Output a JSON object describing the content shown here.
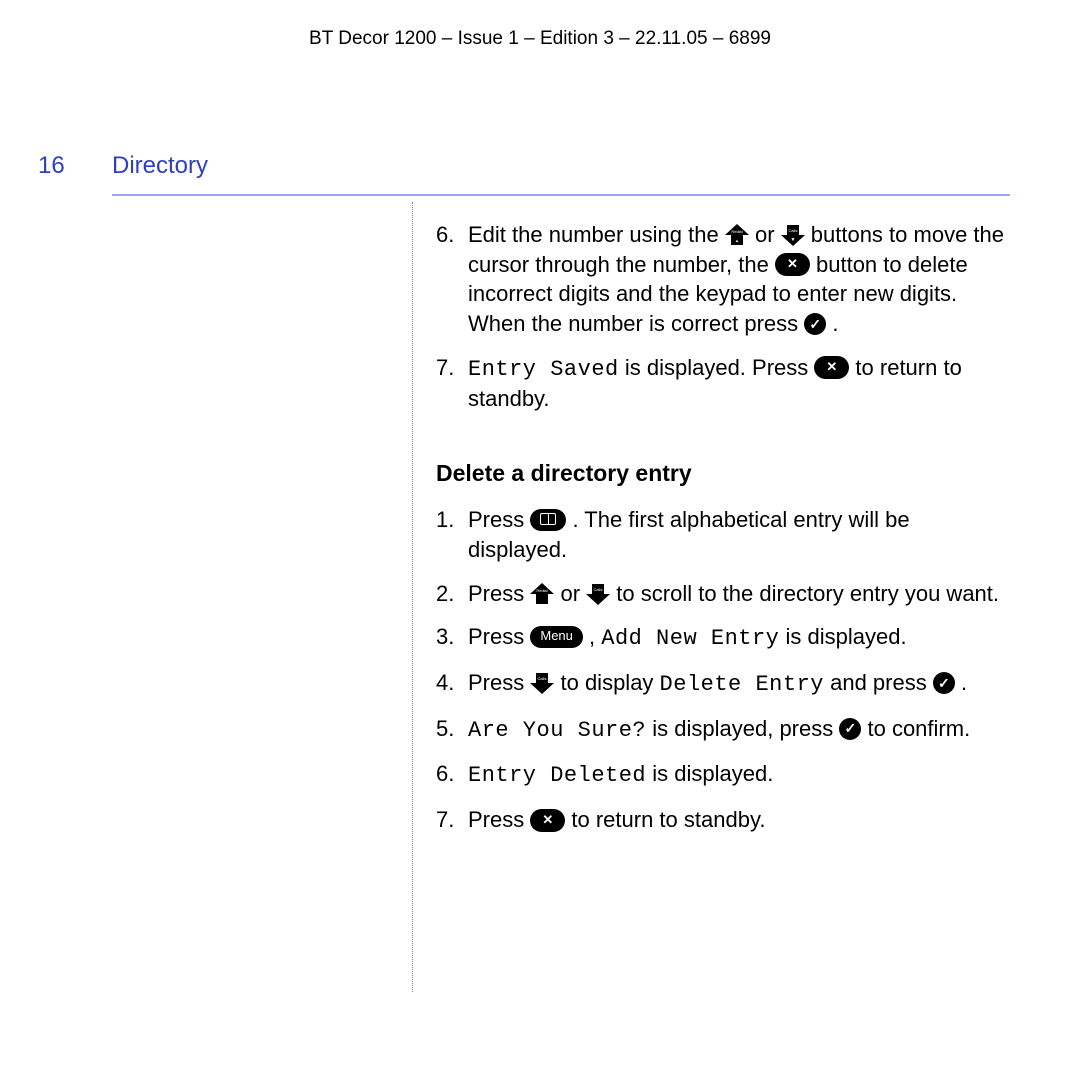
{
  "header": "BT Decor 1200 – Issue 1 – Edition 3 – 22.11.05 – 6899",
  "page_number": "16",
  "section_title": "Directory",
  "icons": {
    "up_label": "Redial",
    "down_label": "Calls",
    "menu_label": "Menu"
  },
  "continued_steps": {
    "6": {
      "t1": "Edit the number using the ",
      "t2": " or ",
      "t3": " buttons to move the cursor through the number, the ",
      "t4": " button to delete incorrect digits and the keypad to enter new digits. When the number is correct press ",
      "t5": "."
    },
    "7": {
      "lcd": "Entry Saved",
      "t1": " is displayed. Press ",
      "t2": " to return to standby."
    }
  },
  "subheading": "Delete a directory entry",
  "delete_steps": {
    "1": {
      "t1": "Press ",
      "t2": ". The first alphabetical entry will be displayed."
    },
    "2": {
      "t1": "Press ",
      "t2": " or ",
      "t3": " to scroll to the directory entry you want."
    },
    "3": {
      "t1": "Press ",
      "t2": ", ",
      "lcd": "Add New Entry",
      "t3": " is displayed."
    },
    "4": {
      "t1": "Press ",
      "t2": " to display ",
      "lcd": "Delete Entry",
      "t3": " and press ",
      "t4": "."
    },
    "5": {
      "lcd": "Are You Sure?",
      "t1": " is displayed, press ",
      "t2": " to confirm."
    },
    "6": {
      "lcd": "Entry Deleted",
      "t1": " is displayed."
    },
    "7": {
      "t1": "Press ",
      "t2": " to return to standby."
    }
  }
}
